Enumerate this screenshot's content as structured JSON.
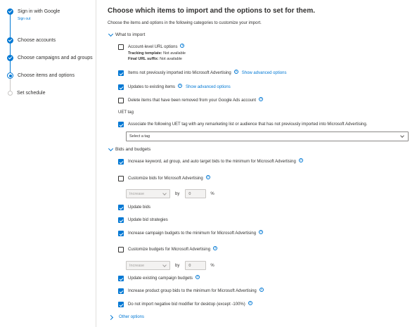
{
  "stepper": {
    "steps": [
      {
        "label": "Sign in with Google",
        "sub": "Sign out",
        "state": "done"
      },
      {
        "label": "Choose accounts",
        "state": "done"
      },
      {
        "label": "Choose campaigns and ad groups",
        "state": "done"
      },
      {
        "label": "Choose items and options",
        "state": "current"
      },
      {
        "label": "Set schedule",
        "state": "pending"
      }
    ]
  },
  "main": {
    "title": "Choose which items to import and the options to set for them.",
    "description": "Choose the items and options in the following categories to customize your import.",
    "what_to_import": {
      "label": "What to import",
      "account_level": {
        "label": "Account-level URL options",
        "checked": false,
        "tracking_label": "Tracking template:",
        "tracking_value": "Not available",
        "final_url_label": "Final URL suffix:",
        "final_url_value": "Not available"
      },
      "items_not_imported": {
        "label": "Items not previously imported into Microsoft Advertising",
        "checked": true,
        "link": "Show advanced options"
      },
      "updates_existing": {
        "label": "Updates to existing items",
        "checked": true,
        "link": "Show advanced options"
      },
      "delete_removed": {
        "label": "Delete items that have been removed from your Google Ads account",
        "checked": false
      },
      "uet_tag_label": "UET tag",
      "associate_uet": {
        "label": "Associate the following UET tag with any remarketing list or audience that has not previously imported into Microsoft Advertising.",
        "checked": true
      },
      "tag_select": "Select a tag"
    },
    "bids_and_budgets": {
      "label": "Bids and budgets",
      "increase_bids": {
        "label": "Increase keyword, ad group, and auto target bids to the minimum for Microsoft Advertising",
        "checked": true
      },
      "customize_bids": {
        "label": "Customize bids for Microsoft Advertising",
        "checked": false
      },
      "bids_adjust": {
        "direction": "Increase",
        "by": "by",
        "value": "0",
        "unit": "%"
      },
      "update_bids": {
        "label": "Update bids",
        "checked": true
      },
      "update_bid_strategies": {
        "label": "Update bid strategies",
        "checked": true
      },
      "increase_campaign_budgets": {
        "label": "Increase campaign budgets to the minimum for Microsoft Advertising",
        "checked": true
      },
      "customize_budgets": {
        "label": "Customize budgets for Microsoft Advertising",
        "checked": false
      },
      "budgets_adjust": {
        "direction": "Increase",
        "by": "by",
        "value": "0",
        "unit": "%"
      },
      "update_campaign_budgets": {
        "label": "Update existing campaign budgets",
        "checked": true
      },
      "increase_product_group_bids": {
        "label": "Increase product group bids to the minimum for Microsoft Advertising",
        "checked": true
      },
      "no_negative_modifier": {
        "label": "Do not import negative bid modifier for desktop (except -100%)",
        "checked": true
      }
    },
    "other_options": {
      "label": "Other options"
    },
    "help_glyph": "?"
  },
  "colors": {
    "accent": "#0078d4",
    "text": "#323130",
    "border": "#e1dfdd"
  },
  "icons": [
    "check-icon",
    "chevron-down-icon",
    "chevron-right-icon",
    "help-icon"
  ]
}
